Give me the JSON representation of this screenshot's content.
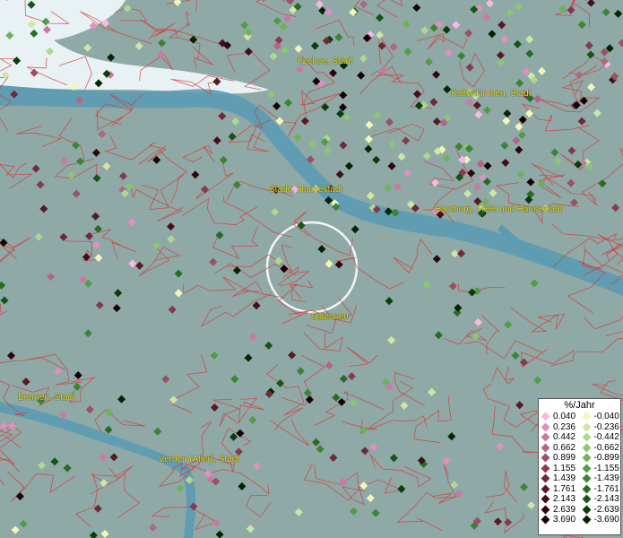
{
  "map": {
    "cities": [
      {
        "name": "Itzehoe, Stadt"
      },
      {
        "name": "Kaltenkirchen, Stadt"
      },
      {
        "name": "Stade, Hansestadt"
      },
      {
        "name": "Hamburg, Freie und Hansestadt"
      },
      {
        "name": "Sittensen"
      },
      {
        "name": "Bremen, Stadt"
      },
      {
        "name": "Verden (Aller), Stadt"
      }
    ],
    "colors": {
      "land": "#8fa9a7",
      "water": "#5b9bb4",
      "sea_ice": "#e8f1f4",
      "boundary": "#d63a3a",
      "label": "#e6df2a"
    }
  },
  "legend": {
    "title": "%/Jahr",
    "positive": [
      {
        "label": "0.040",
        "color": "#f6b9e0"
      },
      {
        "label": "0.236",
        "color": "#e08fc0"
      },
      {
        "label": "0.442",
        "color": "#c97aa3"
      },
      {
        "label": "0.662",
        "color": "#b26684"
      },
      {
        "label": "0.899",
        "color": "#9c4f67"
      },
      {
        "label": "1.155",
        "color": "#853b4e"
      },
      {
        "label": "1.439",
        "color": "#6e2a38"
      },
      {
        "label": "1.761",
        "color": "#571b26"
      },
      {
        "label": "2.143",
        "color": "#420f18"
      },
      {
        "label": "2.639",
        "color": "#2c060c"
      },
      {
        "label": "3.690",
        "color": "#170003"
      }
    ],
    "negative": [
      {
        "label": "-0.040",
        "color": "#f2f7b9"
      },
      {
        "label": "-0.236",
        "color": "#cfe7a3"
      },
      {
        "label": "-0.442",
        "color": "#aed88c"
      },
      {
        "label": "-0.662",
        "color": "#8cc574"
      },
      {
        "label": "-0.899",
        "color": "#6fb25c"
      },
      {
        "label": "-1.155",
        "color": "#539b47"
      },
      {
        "label": "-1.439",
        "color": "#3c8434"
      },
      {
        "label": "-1.761",
        "color": "#286c24"
      },
      {
        "label": "-2.143",
        "color": "#175417"
      },
      {
        "label": "-2.639",
        "color": "#0b3c0c"
      },
      {
        "label": "-3.690",
        "color": "#022404"
      }
    ]
  }
}
